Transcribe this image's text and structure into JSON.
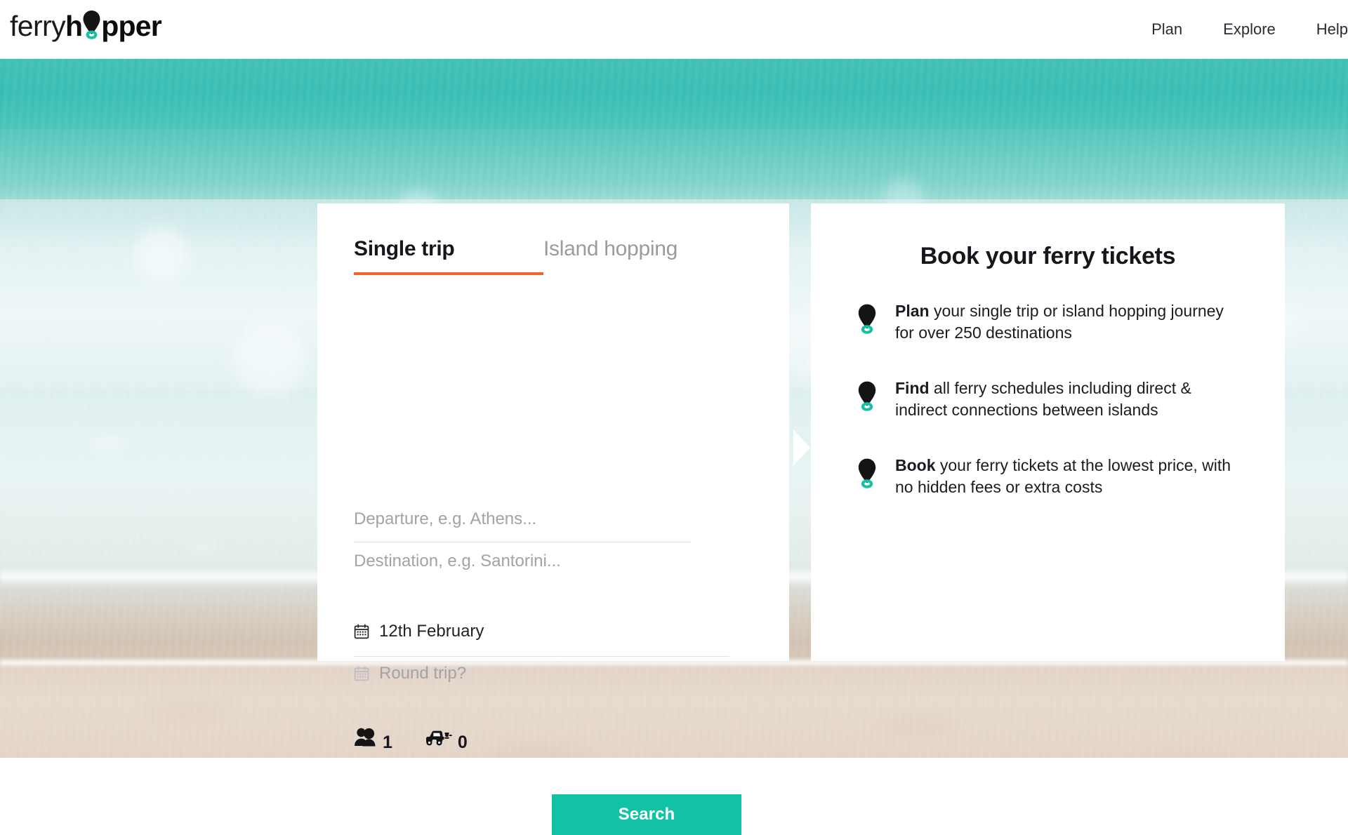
{
  "brand": {
    "name_light": "ferry",
    "name_bold_pre": "h",
    "name_bold_post": "pper",
    "pin_color": "#141414",
    "pin_ring_color": "#12c2a4"
  },
  "nav": {
    "items": [
      {
        "label": "Plan"
      },
      {
        "label": "Explore"
      },
      {
        "label": "Help"
      }
    ]
  },
  "search_card": {
    "tabs": [
      {
        "id": "single-trip",
        "label": "Single trip",
        "active": true
      },
      {
        "id": "island-hopping",
        "label": "Island hopping",
        "active": false
      }
    ],
    "active_tab_underline_color": "#f4632a",
    "departure": {
      "placeholder": "Departure, e.g. Athens...",
      "value": ""
    },
    "destination": {
      "placeholder": "Destination, e.g. Santorini...",
      "value": ""
    },
    "swap_icon": "swap-vertical-arrows-icon",
    "date_out": {
      "value": "12th February",
      "icon": "calendar-icon"
    },
    "date_return": {
      "placeholder": "Round trip?",
      "value": "",
      "icon": "calendar-icon"
    },
    "passengers": {
      "icon": "passengers-icon",
      "count": "1"
    },
    "vehicles": {
      "icon": "vehicle-icon",
      "count": "0"
    },
    "search_button": {
      "label": "Search",
      "color": "#12c2a4"
    }
  },
  "info_card": {
    "title": "Book your ferry tickets",
    "items": [
      {
        "icon": "location-pin-icon",
        "lead": "Plan",
        "rest": " your single trip or island hopping journey for over 250 destinations"
      },
      {
        "icon": "location-pin-icon",
        "lead": "Find",
        "rest": " all ferry schedules including direct & indirect connections between islands"
      },
      {
        "icon": "location-pin-icon",
        "lead": "Book",
        "rest": " your ferry tickets at the lowest price, with no hidden fees or extra costs"
      }
    ]
  }
}
